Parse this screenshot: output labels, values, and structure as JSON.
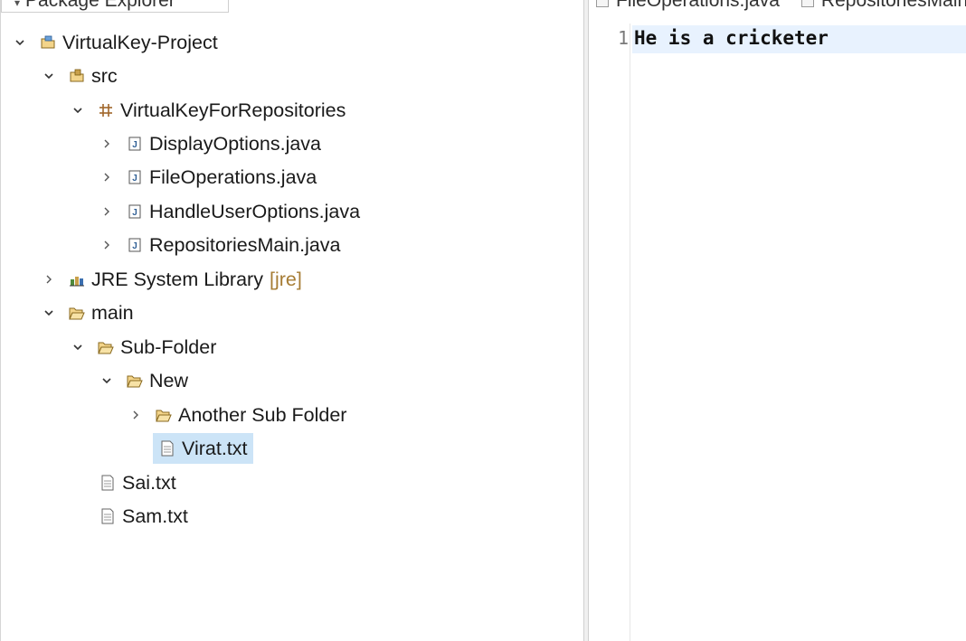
{
  "explorer": {
    "tab_title": "Package Explorer",
    "tree": [
      {
        "label": "VirtualKey-Project",
        "icon": "project-icon",
        "expanded": true
      },
      {
        "label": "src",
        "icon": "source-folder-icon",
        "expanded": true
      },
      {
        "label": "VirtualKeyForRepositories",
        "icon": "package-icon",
        "expanded": true
      },
      {
        "label": "DisplayOptions.java",
        "icon": "java-file-icon",
        "expanded": false
      },
      {
        "label": "FileOperations.java",
        "icon": "java-file-icon",
        "expanded": false
      },
      {
        "label": "HandleUserOptions.java",
        "icon": "java-file-icon",
        "expanded": false
      },
      {
        "label": "RepositoriesMain.java",
        "icon": "java-file-icon",
        "expanded": false
      },
      {
        "label": "JRE System Library",
        "decoration": "[jre]",
        "icon": "library-icon",
        "expanded": false
      },
      {
        "label": "main",
        "icon": "folder-icon",
        "expanded": true
      },
      {
        "label": "Sub-Folder",
        "icon": "folder-icon",
        "expanded": true
      },
      {
        "label": "New",
        "icon": "folder-icon",
        "expanded": true
      },
      {
        "label": "Another Sub Folder",
        "icon": "folder-icon",
        "expanded": false
      },
      {
        "label": "Virat.txt",
        "icon": "text-file-icon",
        "selected": true
      },
      {
        "label": "Sai.txt",
        "icon": "text-file-icon"
      },
      {
        "label": "Sam.txt",
        "icon": "text-file-icon"
      }
    ]
  },
  "editor": {
    "tabs": [
      "FileOperations.java",
      "RepositoriesMain.java"
    ],
    "lines": [
      {
        "number": "1",
        "text": "He is a cricketer"
      }
    ]
  },
  "colors": {
    "selection": "#cce4f7",
    "current_line": "#e8f2fe",
    "decoration": "#a67c34"
  }
}
